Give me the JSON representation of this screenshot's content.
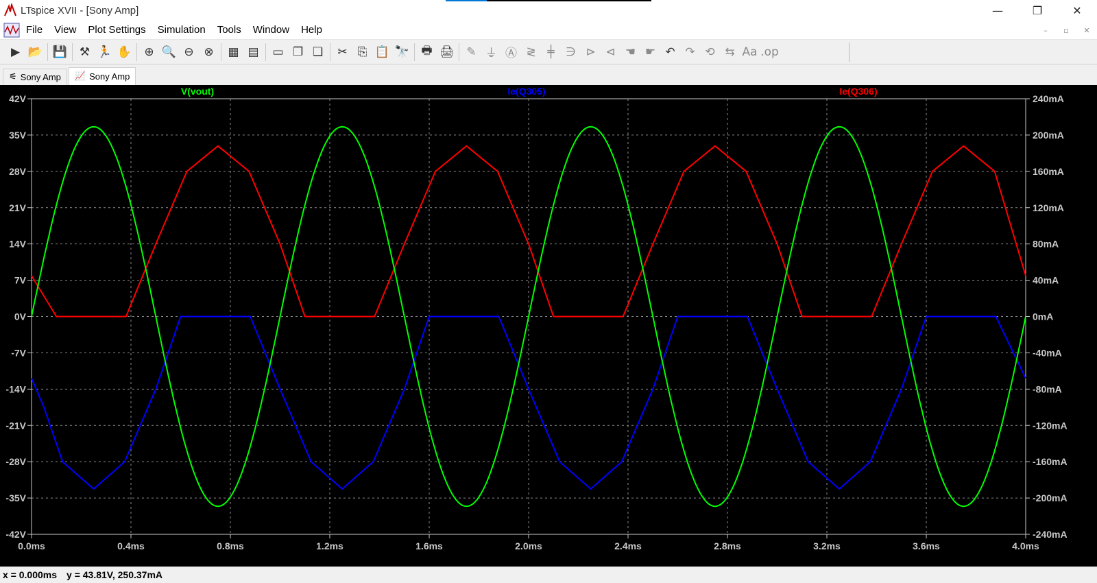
{
  "window": {
    "title": "LTspice XVII - [Sony Amp]",
    "controls": [
      "—",
      "❐",
      "✕"
    ],
    "mdi_controls": [
      "–",
      "▫",
      "✕"
    ]
  },
  "menu": [
    "File",
    "View",
    "Plot Settings",
    "Simulation",
    "Tools",
    "Window",
    "Help"
  ],
  "toolbar": {
    "buttons": [
      {
        "icon": "run-icon",
        "glyph": "▶"
      },
      {
        "icon": "open-icon",
        "glyph": "📂"
      },
      {
        "sep": true
      },
      {
        "icon": "save-icon",
        "glyph": "💾"
      },
      {
        "sep": true
      },
      {
        "icon": "control-panel-icon",
        "glyph": "⚒"
      },
      {
        "icon": "run-man-icon",
        "glyph": "🏃"
      },
      {
        "icon": "halt-hand-icon",
        "glyph": "✋"
      },
      {
        "sep": true
      },
      {
        "icon": "zoom-in-icon",
        "glyph": "⊕"
      },
      {
        "icon": "zoom-area-icon",
        "glyph": "🔍"
      },
      {
        "icon": "zoom-out-icon",
        "glyph": "⊖"
      },
      {
        "icon": "zoom-cancel-icon",
        "glyph": "⊗"
      },
      {
        "sep": true
      },
      {
        "icon": "autorange-icon",
        "glyph": "▦"
      },
      {
        "icon": "grid-icon",
        "glyph": "▤"
      },
      {
        "sep": true
      },
      {
        "icon": "tile-horizontal-icon",
        "glyph": "▭"
      },
      {
        "icon": "cascade-icon",
        "glyph": "❐"
      },
      {
        "icon": "tile-vertical-icon",
        "glyph": "❏"
      },
      {
        "sep": true
      },
      {
        "icon": "cut-icon",
        "glyph": "✂"
      },
      {
        "icon": "copy-icon",
        "glyph": "⎘"
      },
      {
        "icon": "paste-icon",
        "glyph": "📋"
      },
      {
        "icon": "find-icon",
        "glyph": "🔭"
      },
      {
        "sep": true
      },
      {
        "icon": "print-icon",
        "glyph": "🖶"
      },
      {
        "icon": "print-preview-icon",
        "glyph": "🖨"
      },
      {
        "sep": true
      },
      {
        "icon": "wire-icon",
        "glyph": "✎",
        "dim": true
      },
      {
        "icon": "ground-icon",
        "glyph": "⏚",
        "dim": true
      },
      {
        "icon": "label-net-icon",
        "glyph": "Ⓐ",
        "dim": true
      },
      {
        "icon": "resistor-icon",
        "glyph": "≷",
        "dim": true
      },
      {
        "icon": "capacitor-icon",
        "glyph": "╪",
        "dim": true
      },
      {
        "icon": "inductor-icon",
        "glyph": "∋",
        "dim": true
      },
      {
        "icon": "diode-icon",
        "glyph": "⊳",
        "dim": true
      },
      {
        "icon": "component-icon",
        "glyph": "⊲",
        "dim": true
      },
      {
        "icon": "move-hand-icon",
        "glyph": "☚",
        "dim": true
      },
      {
        "icon": "drag-hand-icon",
        "glyph": "☛",
        "dim": true
      },
      {
        "icon": "undo-icon",
        "glyph": "↶"
      },
      {
        "icon": "redo-icon",
        "glyph": "↷",
        "dim": true
      },
      {
        "icon": "rotate-icon",
        "glyph": "⟲",
        "dim": true
      },
      {
        "icon": "mirror-icon",
        "glyph": "⇆",
        "dim": true
      },
      {
        "icon": "text-icon",
        "glyph": "Aa",
        "dim": true
      },
      {
        "icon": "spice-directive-icon",
        "glyph": ".op",
        "dim": true
      }
    ]
  },
  "tabs": [
    {
      "label": "Sony Amp",
      "icon": "schematic-icon",
      "glyph": "⚟",
      "active": false
    },
    {
      "label": "Sony Amp",
      "icon": "waveform-icon",
      "glyph": "📈",
      "active": true
    }
  ],
  "plot": {
    "traces": [
      {
        "label": "V(vout)",
        "color": "#00ff00"
      },
      {
        "label": "Ie(Q305)",
        "color": "#0000ff"
      },
      {
        "label": "Ie(Q306)",
        "color": "#ff0000"
      }
    ],
    "left_ticks": [
      "42V",
      "35V",
      "28V",
      "21V",
      "14V",
      "7V",
      "0V",
      "-7V",
      "-14V",
      "-21V",
      "-28V",
      "-35V",
      "-42V"
    ],
    "right_ticks": [
      "240mA",
      "200mA",
      "160mA",
      "120mA",
      "80mA",
      "40mA",
      "0mA",
      "-40mA",
      "-80mA",
      "-120mA",
      "-160mA",
      "-200mA",
      "-240mA"
    ],
    "x_ticks": [
      "0.0ms",
      "0.4ms",
      "0.8ms",
      "1.2ms",
      "1.6ms",
      "2.0ms",
      "2.4ms",
      "2.8ms",
      "3.2ms",
      "3.6ms",
      "4.0ms"
    ],
    "grid_color": "#8c8c8c",
    "frame_color": "#c8c8c8",
    "text_color": "#c8c8c8"
  },
  "chart_data": {
    "type": "line",
    "xlabel": "",
    "x_unit": "ms",
    "xlim": [
      0,
      4.0
    ],
    "y_left_lim": [
      -42,
      42
    ],
    "y_right_lim": [
      -240,
      240
    ],
    "grid": true,
    "series": [
      {
        "name": "V(vout)",
        "axis": "left",
        "unit": "V",
        "color": "#00ff00",
        "x": [
          0,
          0.125,
          0.25,
          0.375,
          0.5,
          0.625,
          0.75,
          0.875,
          1.0,
          1.125,
          1.25,
          1.375,
          1.5,
          1.625,
          1.75,
          1.875,
          2.0,
          2.125,
          2.25,
          2.375,
          2.5,
          2.625,
          2.75,
          2.875,
          3.0,
          3.125,
          3.25,
          3.375,
          3.5,
          3.625,
          3.75,
          3.875,
          4.0
        ],
        "values": [
          0,
          25.9,
          36.6,
          25.9,
          0,
          -25.9,
          -36.6,
          -25.9,
          0,
          25.9,
          36.6,
          25.9,
          0,
          -25.9,
          -36.6,
          -25.9,
          0,
          25.9,
          36.6,
          25.9,
          0,
          -25.9,
          -36.6,
          -25.9,
          0,
          25.9,
          36.6,
          25.9,
          0,
          -25.9,
          -36.6,
          -25.9,
          0
        ]
      },
      {
        "name": "Ie(Q305)",
        "axis": "right",
        "unit": "mA",
        "color": "#0000ff",
        "x": [
          0,
          0.05,
          0.125,
          0.25,
          0.375,
          0.5,
          0.6,
          0.75,
          0.88,
          1.0,
          1.125,
          1.25,
          1.375,
          1.5,
          1.6,
          1.75,
          1.88,
          2.0,
          2.125,
          2.25,
          2.375,
          2.5,
          2.6,
          2.75,
          2.88,
          3.0,
          3.125,
          3.25,
          3.375,
          3.5,
          3.6,
          3.75,
          3.88,
          4.0
        ],
        "values": [
          -68,
          -100,
          -160,
          -190,
          -160,
          -80,
          0,
          0,
          0,
          -80,
          -160,
          -190,
          -160,
          -80,
          0,
          0,
          0,
          -80,
          -160,
          -190,
          -160,
          -80,
          0,
          0,
          0,
          -80,
          -160,
          -190,
          -160,
          -80,
          0,
          0,
          0,
          -68
        ]
      },
      {
        "name": "Ie(Q306)",
        "axis": "right",
        "unit": "mA",
        "color": "#ff0000",
        "x": [
          0,
          0.1,
          0.25,
          0.38,
          0.5,
          0.625,
          0.75,
          0.875,
          1.0,
          1.1,
          1.25,
          1.38,
          1.5,
          1.625,
          1.75,
          1.875,
          2.0,
          2.1,
          2.25,
          2.38,
          2.5,
          2.625,
          2.75,
          2.875,
          3.0,
          3.1,
          3.25,
          3.38,
          3.5,
          3.625,
          3.75,
          3.875,
          4.0
        ],
        "values": [
          45,
          0,
          0,
          0,
          80,
          160,
          188,
          160,
          80,
          0,
          0,
          0,
          80,
          160,
          188,
          160,
          80,
          0,
          0,
          0,
          80,
          160,
          188,
          160,
          80,
          0,
          0,
          0,
          80,
          160,
          188,
          160,
          45
        ]
      }
    ]
  },
  "status": {
    "x": "x = 0.000ms",
    "y": "y = 43.81V, 250.37mA"
  }
}
